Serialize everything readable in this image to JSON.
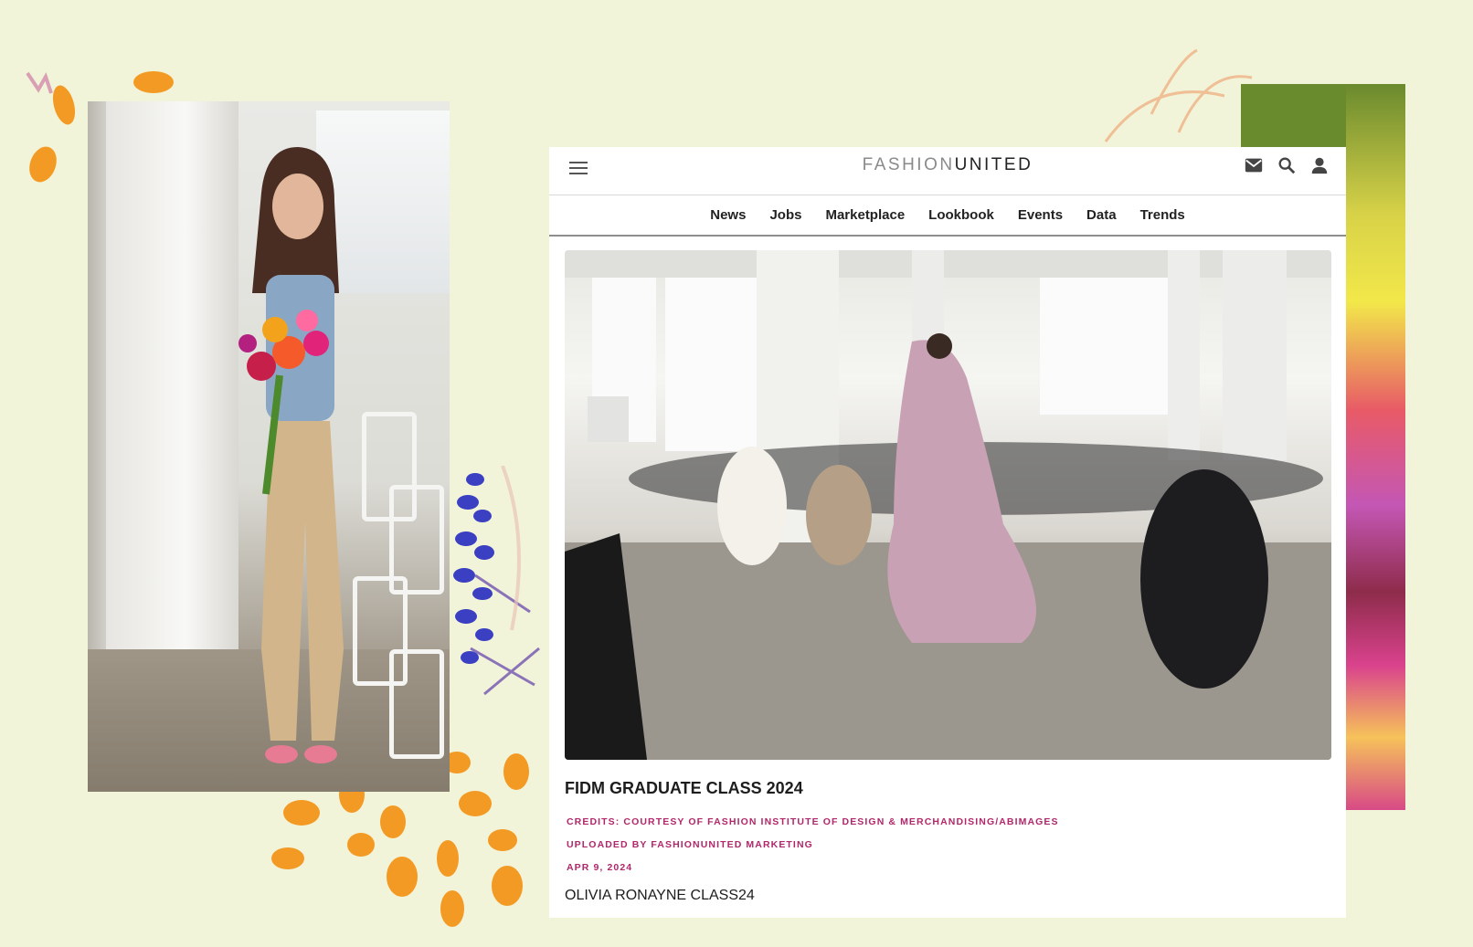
{
  "card": {
    "logo_light": "FASHION",
    "logo_bold": "UNITED",
    "nav": [
      "News",
      "Jobs",
      "Marketplace",
      "Lookbook",
      "Events",
      "Data",
      "Trends"
    ],
    "icons": {
      "menu": "hamburger-menu-icon",
      "mail": "mail-icon",
      "search": "search-icon",
      "account": "user-icon"
    },
    "article": {
      "title": "FIDM GRADUATE CLASS 2024",
      "credits": "CREDITS: COURTESY OF FASHION INSTITUTE OF DESIGN & MERCHANDISING/ABIMAGES",
      "uploaded": "UPLOADED BY FASHIONUNITED MARKETING",
      "date": "APR 9, 2024",
      "caption": "OLIVIA RONAYNE CLASS24"
    }
  },
  "colors": {
    "background": "#f2f4d9",
    "meta_accent": "#b0276a",
    "petal_orange": "#f39a24",
    "lupine_blue": "#3b3fc2"
  }
}
